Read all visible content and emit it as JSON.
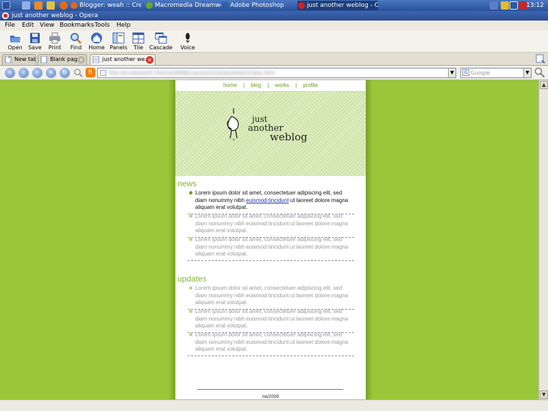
{
  "taskbar": {
    "tasks": [
      {
        "label": "Blogger: weah :: Create ..."
      },
      {
        "label": "Macromedia Dreamweav..."
      },
      {
        "label": "Adobe Photoshop"
      },
      {
        "label": "just another weblog - Op..."
      }
    ],
    "clock": "13:12"
  },
  "window": {
    "title": "just another weblog - Opera"
  },
  "menu": [
    "File",
    "Edit",
    "View",
    "Bookmarks",
    "Tools",
    "Help"
  ],
  "toolbar": [
    "Open",
    "Save",
    "Print",
    "Find",
    "Home",
    "Panels",
    "Tile",
    "Cascade",
    "Voice"
  ],
  "tabs": [
    {
      "label": "New tab"
    },
    {
      "label": "Blank page"
    },
    {
      "label": "just another we..."
    }
  ],
  "address": {
    "url_obscured": "file://localhost/E:/Home/WEB/Layouts/just/another/index.htm",
    "search_placeholder": "Google"
  },
  "site": {
    "nav": [
      "home",
      "blog",
      "works",
      "profile"
    ],
    "logo_lines": [
      "just",
      "another",
      "weblog"
    ],
    "sections": [
      {
        "title": "news",
        "posts": [
          {
            "pre": "Lorem ipsum dolor sit amet, consectetuer adipiscing elit, sed diam nonummy nibh ",
            "link": "euismod tincidunt",
            "post": " ut laoreet dolore magna aliquam erat volutpat."
          },
          {
            "text": "Lorem ipsum dolor sit amet, consectetuer adipiscing elit, sed diam nonummy nibh euismod tincidunt ut laoreet dolore magna aliquam erat volutpat."
          },
          {
            "text": "Lorem ipsum dolor sit amet, consectetuer adipiscing elit, sed diam nonummy nibh euismod tincidunt ut laoreet dolore magna aliquam erat volutpat."
          }
        ]
      },
      {
        "title": "updates",
        "posts": [
          {
            "text": "Lorem ipsum dolor sit amet, consectetuer adipiscing elit, sed diam nonummy nibh euismod tincidunt ut laoreet dolore magna aliquam erat volutpat."
          },
          {
            "text": "Lorem ipsum dolor sit amet, consectetuer adipiscing elit, sed diam nonummy nibh euismod tincidunt ut laoreet dolore magna aliquam erat volutpat."
          },
          {
            "text": "Lorem ipsum dolor sit amet, consectetuer adipiscing elit, sed diam nonummy nibh euismod tincidunt ut laoreet dolore magna aliquam erat volutpat."
          }
        ]
      }
    ],
    "footer": "nw2006"
  },
  "colors": {
    "page_bg": "#9ac739",
    "accent": "#86b82a",
    "link": "#2233aa"
  }
}
